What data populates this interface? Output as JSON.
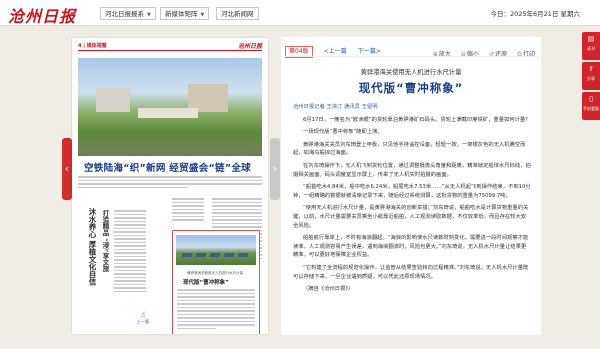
{
  "header": {
    "logo": "沧州日报",
    "selects": [
      {
        "label": "河北日报报系"
      },
      {
        "label": "新媒体矩阵"
      },
      {
        "label": "河北新闻网"
      }
    ],
    "date": "今日：2025年6月21日 星期六"
  },
  "left_page": {
    "page_number": "4 | 媒体视窗",
    "masthead": "沧州日报",
    "lead_headline": "空铁陆海“织”新网 经贸盛会“链”全球",
    "vertical_headline": "沐水养心 厚植文化自信",
    "vertical_headline_2": "打造精品 “浸”享文旅",
    "article_subtitle": "黄骅港海关使用无人机进行水尺计量",
    "article_title": "现代版“曹冲称象”",
    "side_headline": "沧州 120 家“中华老字号”",
    "stamp_label": "上一版"
  },
  "arrows": {
    "prev": "‹",
    "next": "›"
  },
  "article": {
    "page_chip": "第04版",
    "prev_label": "<上一篇",
    "next_label": "下一篇>",
    "tools": [
      {
        "icon": "🔍",
        "label": "放大"
      },
      {
        "icon": "🔍",
        "label": "缩小"
      },
      {
        "icon": "↺",
        "label": "还原"
      },
      {
        "icon": "🖨",
        "label": "打印"
      }
    ],
    "kicker": "黄骅港海关使用无人机进行水尺计量",
    "title": "现代版“曹冲称象”",
    "paragraphs": [
      {
        "text": "沧州日报记者 王浓汀 通讯员 王留明",
        "meta": true
      },
      {
        "text": "6月17日，一艘名为“欧洲眼”的货轮靠泊黄骅港矿石码头。货轮上满载印度铁矿，重量如何计量？"
      },
      {
        "text": "一场现代版“曹冲称象”随即上演。"
      },
      {
        "text": "黄骅港海关关员刘东琦登上甲板，只见他手持遥控设备，轻轻一按，一架银灰色的无人机腾空而起，如海鸟般掠过海面。"
      },
      {
        "text": "在刘东琦操作下，无人机飞到货轮位置，通过调整摄像头角度和距离，精准锁定船体水尺标线，拍摄相关画面。码头调度室显示屏上，传来了无人机实时拍摄的画面。"
      },
      {
        "text": "“船首吃水4.84米，船中吃水6.24米，船尾吃水7.53米……”从无人机起飞到操作结束，不到10分钟，一组精确的数据就被清晰记录下来，随后经过系统测算，这批货物的重量为75099.7吨。"
      },
      {
        "text": "“使用无人机进行水尺计量，是黄骅港海关的创新举措。”刘东琦说，船舶吃水是计算货物重量的关键，以前，水尺计量需要关员乘坐小艇靠近船舶，人工观测读取数据，不仅效率低，而且存在较大安全风险。"
      },
      {
        "text": "船舶航行靠岸上，不时有海浪翻起。“海浪的影响使水尺读数时刻变化，需要进一段时间观察才能读准，人工观测容易产生误差，遇到海浪翻滚时，风险也更大。”刘东琦说，无人机水尺计量让结果更精准，可以更好地保障企业权益。"
      },
      {
        "text": "“它构建了全流程的规范化操作，让监管从结果查验转向过程精准。”刘东琦说，无人机水尺计量既可以存储下来，一旦企业遇到质疑，可以凭此还原现场情况。"
      },
      {
        "text": "（摘自《沧州日报》）"
      }
    ]
  },
  "sidebar": [
    {
      "icon": "📖",
      "label": "读刊"
    },
    {
      "icon": "⇪",
      "label": "分享"
    },
    {
      "icon": "📱",
      "label": "手机看报"
    }
  ],
  "colors": {
    "accent": "#d0242b",
    "title_blue": "#1b3e8a",
    "link": "#2a62b8"
  }
}
